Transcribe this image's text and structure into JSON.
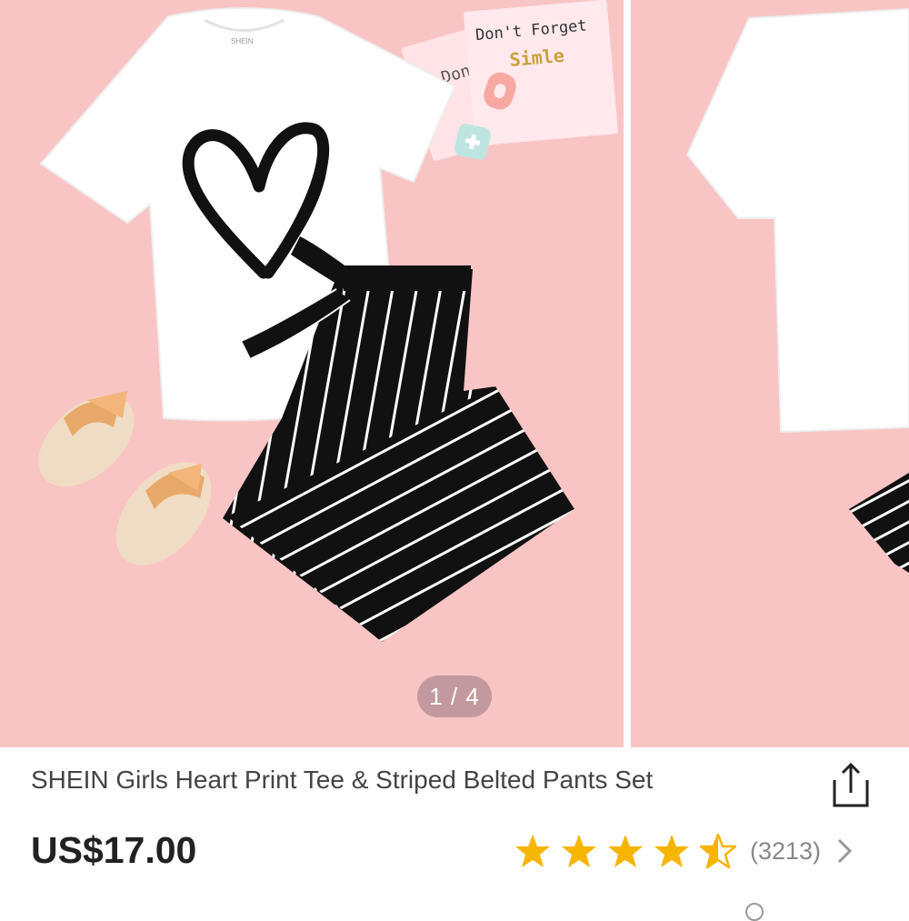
{
  "gallery": {
    "current": 1,
    "total": 4,
    "indicator_text": "1 / 4",
    "card_text_1": "Don't Forget",
    "card_text_2": "Simle",
    "card_text_back": "Don",
    "tee_tag": "SHEIN"
  },
  "product": {
    "title": "SHEIN Girls Heart Print Tee & Striped Belted Pants Set",
    "price": "US$17.00",
    "rating": 4.5,
    "review_count": "(3213)"
  },
  "icons": {
    "share": "share-icon",
    "star": "star-icon",
    "chevron": "chevron-right-icon"
  },
  "colors": {
    "background_pink": "#f9c4c4",
    "star": "#f6b500"
  }
}
